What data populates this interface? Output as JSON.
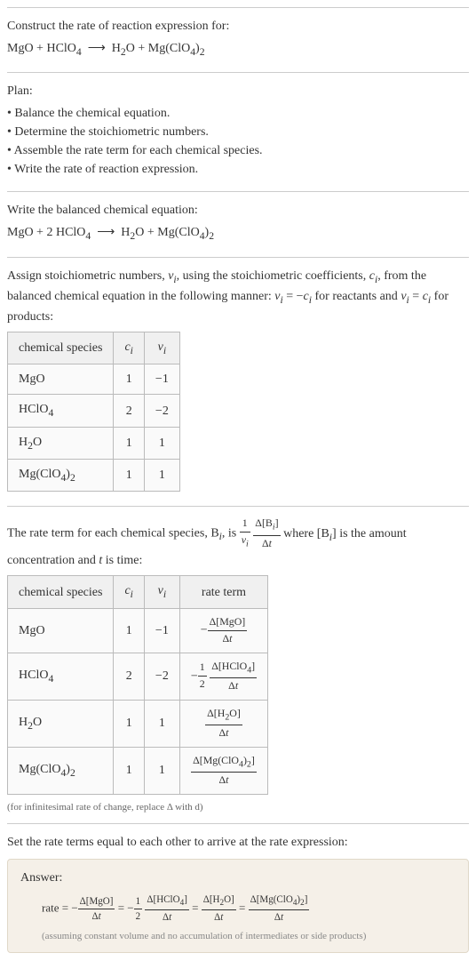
{
  "intro": {
    "title": "Construct the rate of reaction expression for:",
    "equation_unbalanced_html": "MgO + HClO<sub>4</sub> &nbsp;⟶&nbsp; H<sub>2</sub>O + Mg(ClO<sub>4</sub>)<sub>2</sub>"
  },
  "plan": {
    "heading": "Plan:",
    "items": [
      "Balance the chemical equation.",
      "Determine the stoichiometric numbers.",
      "Assemble the rate term for each chemical species.",
      "Write the rate of reaction expression."
    ]
  },
  "balanced": {
    "heading": "Write the balanced chemical equation:",
    "equation_html": "MgO + 2 HClO<sub>4</sub> &nbsp;⟶&nbsp; H<sub>2</sub>O + Mg(ClO<sub>4</sub>)<sub>2</sub>"
  },
  "stoich": {
    "intro_html": "Assign stoichiometric numbers, <span class=\"italic\">ν<sub>i</sub></span>, using the stoichiometric coefficients, <span class=\"italic\">c<sub>i</sub></span>, from the balanced chemical equation in the following manner: <span class=\"italic\">ν<sub>i</sub></span> = −<span class=\"italic\">c<sub>i</sub></span> for reactants and <span class=\"italic\">ν<sub>i</sub></span> = <span class=\"italic\">c<sub>i</sub></span> for products:",
    "headers": {
      "species": "chemical species",
      "ci_html": "<span class=\"italic\">c<sub>i</sub></span>",
      "vi_html": "<span class=\"italic\">ν<sub>i</sub></span>"
    },
    "rows": [
      {
        "species_html": "MgO",
        "ci": "1",
        "vi": "−1"
      },
      {
        "species_html": "HClO<sub>4</sub>",
        "ci": "2",
        "vi": "−2"
      },
      {
        "species_html": "H<sub>2</sub>O",
        "ci": "1",
        "vi": "1"
      },
      {
        "species_html": "Mg(ClO<sub>4</sub>)<sub>2</sub>",
        "ci": "1",
        "vi": "1"
      }
    ]
  },
  "rate_term": {
    "intro_pre": "The rate term for each chemical species, B",
    "intro_mid": ", is ",
    "intro_frac1_num_html": "1",
    "intro_frac1_den_html": "<span class=\"italic\">ν<sub>i</sub></span>",
    "intro_frac2_num_html": "Δ[B<sub><span class=\"italic\">i</span></sub>]",
    "intro_frac2_den_html": "Δ<span class=\"italic\">t</span>",
    "intro_post_html": " where [B<sub><span class=\"italic\">i</span></sub>] is the amount concentration and <span class=\"italic\">t</span> is time:",
    "headers": {
      "species": "chemical species",
      "ci_html": "<span class=\"italic\">c<sub>i</sub></span>",
      "vi_html": "<span class=\"italic\">ν<sub>i</sub></span>",
      "rate": "rate term"
    },
    "rows": [
      {
        "species_html": "MgO",
        "ci": "1",
        "vi": "−1",
        "rate_html": "−<span class=\"frac\"><span class=\"num\">Δ[MgO]</span><span class=\"den\">Δ<span class=\"italic\">t</span></span></span>"
      },
      {
        "species_html": "HClO<sub>4</sub>",
        "ci": "2",
        "vi": "−2",
        "rate_html": "−<span class=\"frac\"><span class=\"num\">1</span><span class=\"den\">2</span></span> <span class=\"frac\"><span class=\"num\">Δ[HClO<sub>4</sub>]</span><span class=\"den\">Δ<span class=\"italic\">t</span></span></span>"
      },
      {
        "species_html": "H<sub>2</sub>O",
        "ci": "1",
        "vi": "1",
        "rate_html": "<span class=\"frac\"><span class=\"num\">Δ[H<sub>2</sub>O]</span><span class=\"den\">Δ<span class=\"italic\">t</span></span></span>"
      },
      {
        "species_html": "Mg(ClO<sub>4</sub>)<sub>2</sub>",
        "ci": "1",
        "vi": "1",
        "rate_html": "<span class=\"frac\"><span class=\"num\">Δ[Mg(ClO<sub>4</sub>)<sub>2</sub>]</span><span class=\"den\">Δ<span class=\"italic\">t</span></span></span>"
      }
    ],
    "note_html": "(for infinitesimal rate of change, replace Δ with d)"
  },
  "final": {
    "heading": "Set the rate terms equal to each other to arrive at the rate expression:",
    "answer_label": "Answer:",
    "answer_html": "rate = −<span class=\"frac\"><span class=\"num\">Δ[MgO]</span><span class=\"den\">Δ<span class=\"italic\">t</span></span></span> = −<span class=\"frac\"><span class=\"num\">1</span><span class=\"den\">2</span></span> <span class=\"frac\"><span class=\"num\">Δ[HClO<sub>4</sub>]</span><span class=\"den\">Δ<span class=\"italic\">t</span></span></span> = <span class=\"frac\"><span class=\"num\">Δ[H<sub>2</sub>O]</span><span class=\"den\">Δ<span class=\"italic\">t</span></span></span> = <span class=\"frac\"><span class=\"num\">Δ[Mg(ClO<sub>4</sub>)<sub>2</sub>]</span><span class=\"den\">Δ<span class=\"italic\">t</span></span></span>",
    "note": "(assuming constant volume and no accumulation of intermediates or side products)"
  }
}
